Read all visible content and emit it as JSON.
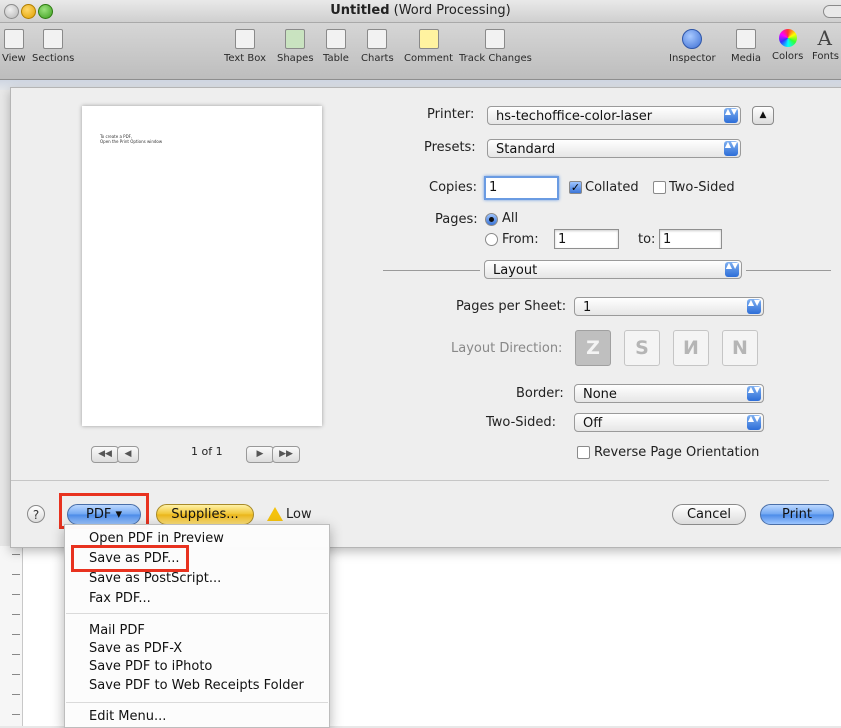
{
  "window": {
    "title_bold": "Untitled",
    "title_rest": " (Word Processing)"
  },
  "toolbar": {
    "view": "View",
    "sections": "Sections",
    "text_box": "Text Box",
    "shapes": "Shapes",
    "table": "Table",
    "charts": "Charts",
    "comment": "Comment",
    "track_changes": "Track Changes",
    "inspector": "Inspector",
    "media": "Media",
    "colors": "Colors",
    "fonts": "Fonts",
    "fonts_glyph": "A"
  },
  "preview": {
    "line1": "To create a PDF,",
    "line2": "Open the Print Options window",
    "page_count": "1 of 1",
    "first": "◀◀",
    "prev": "◀",
    "next": "▶",
    "last": "▶▶"
  },
  "print": {
    "printer_label": "Printer:",
    "printer_value": "hs-techoffice-color-laser",
    "presets_label": "Presets:",
    "presets_value": "Standard",
    "copies_label": "Copies:",
    "copies_value": "1",
    "collated_label": "Collated",
    "two_sided_label": "Two-Sided",
    "pages_label": "Pages:",
    "all_label": "All",
    "from_label": "From:",
    "from_value": "1",
    "to_label": "to:",
    "to_value": "1",
    "section_value": "Layout",
    "pages_per_sheet_label": "Pages per Sheet:",
    "pages_per_sheet_value": "1",
    "layout_direction_label": "Layout Direction:",
    "border_label": "Border:",
    "border_value": "None",
    "two_sided_option_label": "Two-Sided:",
    "two_sided_option_value": "Off",
    "reverse_label": "Reverse Page Orientation",
    "expand_glyph": "▲",
    "popup_arrows": "▲▼"
  },
  "buttons": {
    "help": "?",
    "pdf": "PDF ▾",
    "supplies": "Supplies...",
    "low": "Low",
    "cancel": "Cancel",
    "print": "Print"
  },
  "pdf_menu": {
    "items": [
      "Open PDF in Preview",
      "Save as PDF...",
      "Save as PostScript...",
      "Fax PDF...",
      "Mail PDF",
      "Save as PDF-X",
      "Save PDF to iPhoto",
      "Save PDF to Web Receipts Folder",
      "Edit Menu..."
    ]
  },
  "colors": {
    "highlight": "#e8321f",
    "accent_blue": "#4b8be8",
    "warning": "#f4c20d"
  }
}
